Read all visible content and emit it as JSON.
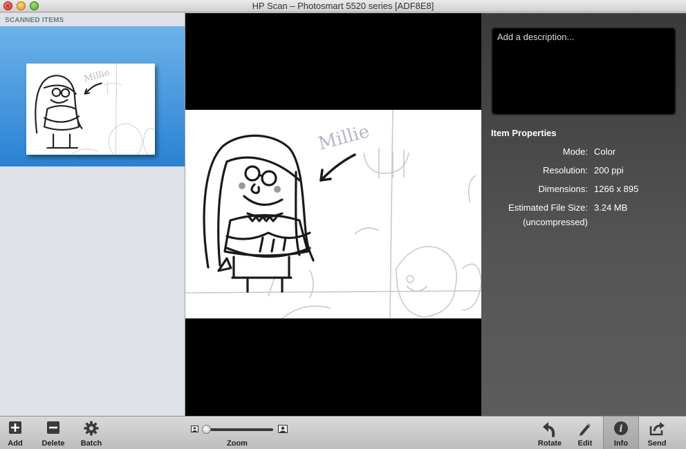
{
  "window": {
    "title": "HP Scan – Photosmart 5520 series [ADF8E8]"
  },
  "sidebar": {
    "header": "SCANNED ITEMS"
  },
  "scan": {
    "handwritten_name": "Millie"
  },
  "info": {
    "description_placeholder": "Add a description...",
    "properties_title": "Item Properties",
    "properties": [
      {
        "label": "Mode:",
        "value": "Color"
      },
      {
        "label": "Resolution:",
        "value": "200 ppi"
      },
      {
        "label": "Dimensions:",
        "value": "1266 x 895"
      },
      {
        "label": "Estimated File Size:",
        "value": "3.24 MB",
        "sub": "(uncompressed)"
      }
    ]
  },
  "toolbar": {
    "add": "Add",
    "delete": "Delete",
    "batch": "Batch",
    "zoom": "Zoom",
    "zoom_level": 0.0,
    "rotate": "Rotate",
    "edit": "Edit",
    "info": "Info",
    "send": "Send"
  },
  "colors": {
    "selection_top": "#6cb2ea",
    "selection_bottom": "#2a82d2",
    "panel_dark": "#3a3a3a"
  }
}
